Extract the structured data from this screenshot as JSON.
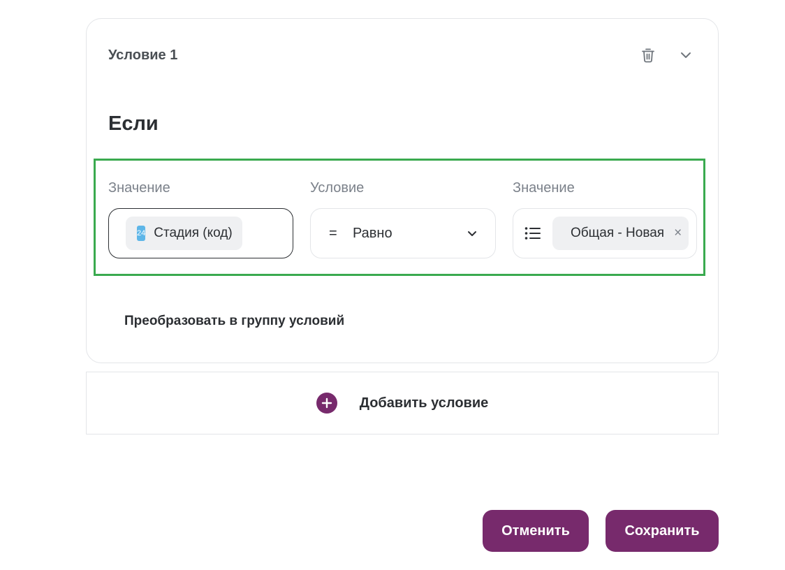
{
  "condition_card": {
    "title": "Условие 1",
    "icons": {
      "delete": "trash-icon",
      "collapse": "chevron-down-icon"
    },
    "if_heading": "Если",
    "row": {
      "left_column": {
        "label": "Значение",
        "chip": {
          "icon_text": "24",
          "icon": "bitrix24-field-icon",
          "text": "Стадия (код)"
        }
      },
      "operator_column": {
        "label": "Условие",
        "symbol": "=",
        "selected": "Равно"
      },
      "right_column": {
        "label": "Значение",
        "list_icon": "list-icon",
        "chip": {
          "text": "Общая - Новая",
          "remove": "×"
        }
      }
    },
    "convert_link": "Преобразовать в группу условий"
  },
  "add_condition": {
    "label": "Добавить условие",
    "icon": "plus-circle-icon"
  },
  "footer": {
    "cancel_label": "Отменить",
    "save_label": "Сохранить"
  },
  "colors": {
    "accent": "#772a6c",
    "highlight_border": "#3aaa4f",
    "chip_icon": "#5eb6e8"
  }
}
